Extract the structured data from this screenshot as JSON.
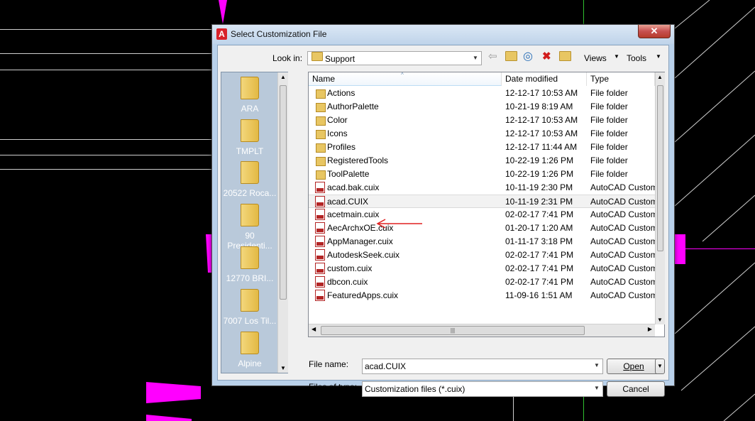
{
  "dialog": {
    "title": "Select Customization File",
    "close_glyph": "✕",
    "app_icon_letter": "A"
  },
  "lookin": {
    "label": "Look in:",
    "value": "Support"
  },
  "toolbar": {
    "back_icon": "back-icon",
    "up_folder_icon": "up-one-level-icon",
    "search_web_icon": "search-web-icon",
    "delete_icon": "delete-icon",
    "new_folder_icon": "new-folder-icon",
    "views_label": "Views",
    "tools_label": "Tools"
  },
  "places": [
    {
      "label": "ARA"
    },
    {
      "label": "TMPLT"
    },
    {
      "label": "20522 Roca..."
    },
    {
      "label": "90 Presidenti..."
    },
    {
      "label": "12770 BRI..."
    },
    {
      "label": "7007 Los Til..."
    },
    {
      "label": "Alpine"
    }
  ],
  "filelist": {
    "headers": {
      "name": "Name",
      "date": "Date modified",
      "type": "Type"
    },
    "rows": [
      {
        "name": "Actions",
        "date": "12-12-17 10:53 AM",
        "type": "File folder",
        "kind": "folder"
      },
      {
        "name": "AuthorPalette",
        "date": "10-21-19 8:19 AM",
        "type": "File folder",
        "kind": "folder"
      },
      {
        "name": "Color",
        "date": "12-12-17 10:53 AM",
        "type": "File folder",
        "kind": "folder"
      },
      {
        "name": "Icons",
        "date": "12-12-17 10:53 AM",
        "type": "File folder",
        "kind": "folder"
      },
      {
        "name": "Profiles",
        "date": "12-12-17 11:44 AM",
        "type": "File folder",
        "kind": "folder"
      },
      {
        "name": "RegisteredTools",
        "date": "10-22-19 1:26 PM",
        "type": "File folder",
        "kind": "folder"
      },
      {
        "name": "ToolPalette",
        "date": "10-22-19 1:26 PM",
        "type": "File folder",
        "kind": "folder"
      },
      {
        "name": "acad.bak.cuix",
        "date": "10-11-19 2:30 PM",
        "type": "AutoCAD Custom",
        "kind": "cuix"
      },
      {
        "name": "acad.CUIX",
        "date": "10-11-19 2:31 PM",
        "type": "AutoCAD Custom",
        "kind": "cuix",
        "selected": true
      },
      {
        "name": "acetmain.cuix",
        "date": "02-02-17 7:41 PM",
        "type": "AutoCAD Custom",
        "kind": "cuix"
      },
      {
        "name": "AecArchxOE.cuix",
        "date": "01-20-17 1:20 AM",
        "type": "AutoCAD Custom",
        "kind": "cuix"
      },
      {
        "name": "AppManager.cuix",
        "date": "01-11-17 3:18 PM",
        "type": "AutoCAD Custom",
        "kind": "cuix"
      },
      {
        "name": "AutodeskSeek.cuix",
        "date": "02-02-17 7:41 PM",
        "type": "AutoCAD Custom",
        "kind": "cuix"
      },
      {
        "name": "custom.cuix",
        "date": "02-02-17 7:41 PM",
        "type": "AutoCAD Custom",
        "kind": "cuix"
      },
      {
        "name": "dbcon.cuix",
        "date": "02-02-17 7:41 PM",
        "type": "AutoCAD Custom",
        "kind": "cuix"
      },
      {
        "name": "FeaturedApps.cuix",
        "date": "11-09-16 1:51 AM",
        "type": "AutoCAD Custom",
        "kind": "cuix"
      }
    ]
  },
  "filename": {
    "label": "File name:",
    "value": "acad.CUIX"
  },
  "filetype": {
    "label": "Files of type:",
    "value": "Customization files (*.cuix)"
  },
  "buttons": {
    "open": "Open",
    "cancel": "Cancel"
  },
  "colors": {
    "cad_background": "#000000",
    "magenta_grip": "#ff00ff",
    "annotation_arrow": "#e02020",
    "dialog_frame": "#b9d1ea"
  }
}
